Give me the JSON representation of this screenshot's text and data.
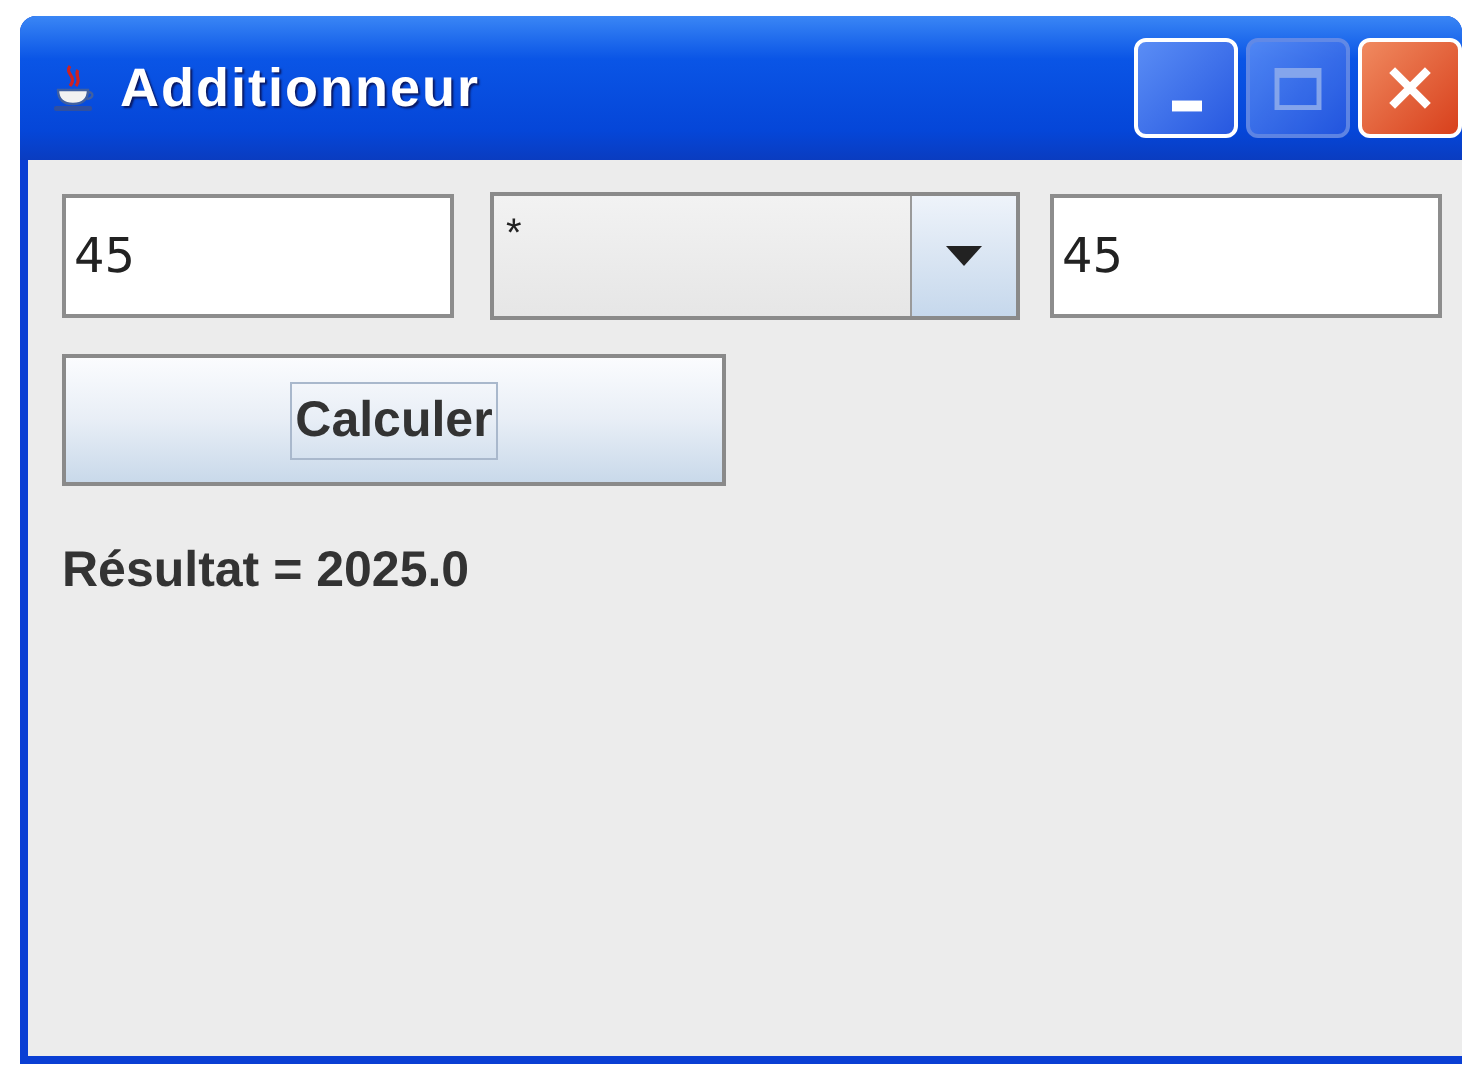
{
  "window": {
    "title": "Additionneur"
  },
  "operand_1": {
    "value": "45"
  },
  "operator": {
    "value": "*"
  },
  "operand_2": {
    "value": "45"
  },
  "calculate_button": {
    "label": "Calculer",
    "focused": true
  },
  "result": "Résultat = 2025.0"
}
